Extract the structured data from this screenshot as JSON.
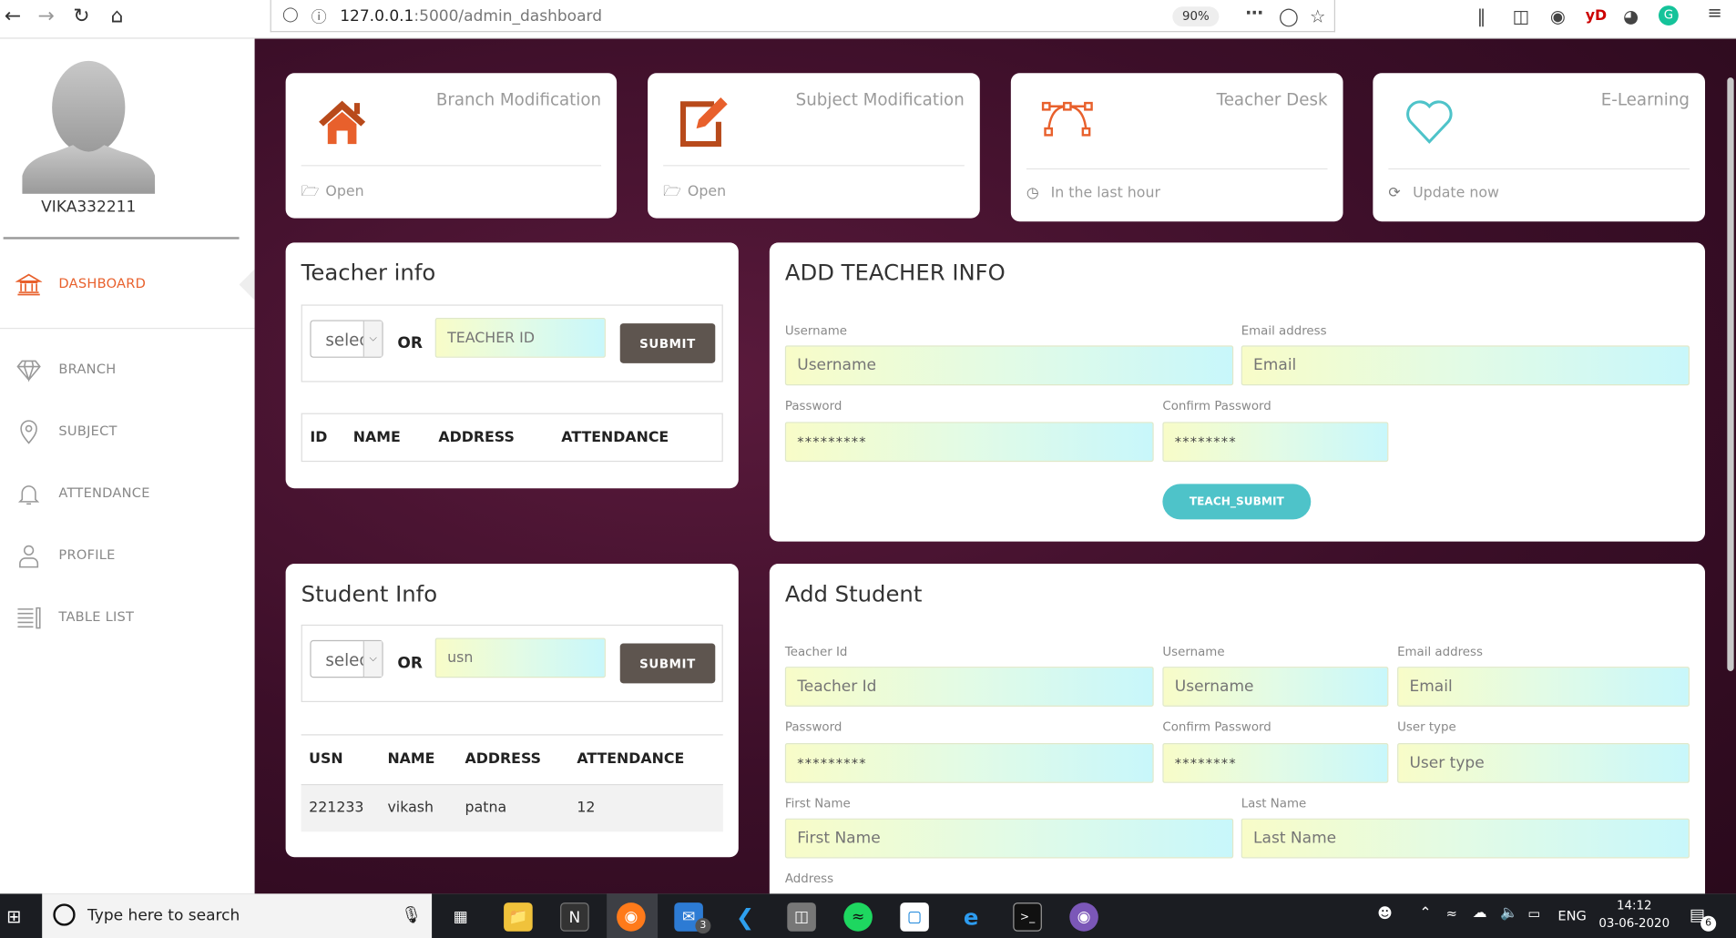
{
  "browser": {
    "url_host": "127.0.0.1",
    "url_rest": ":5000/admin_dashboard",
    "zoom": "90%"
  },
  "sidebar": {
    "username": "VIKA332211",
    "items": [
      {
        "label": "DASHBOARD",
        "icon": "bank-icon",
        "active": true
      },
      {
        "label": "BRANCH",
        "icon": "diamond-icon"
      },
      {
        "label": "SUBJECT",
        "icon": "map-pin-icon"
      },
      {
        "label": "ATTENDANCE",
        "icon": "bell-icon"
      },
      {
        "label": "PROFILE",
        "icon": "user-icon"
      },
      {
        "label": "TABLE LIST",
        "icon": "list-icon"
      }
    ]
  },
  "stats": [
    {
      "title": "Branch Modification",
      "footer": "Open",
      "icon": "home-icon",
      "footer_icon": "folder-open-icon"
    },
    {
      "title": "Subject Modification",
      "footer": "Open",
      "icon": "edit-icon",
      "footer_icon": "folder-open-icon"
    },
    {
      "title": "Teacher Desk",
      "footer": "In the last hour",
      "icon": "vector-path-icon",
      "footer_icon": "clock-icon"
    },
    {
      "title": "E-Learning",
      "footer": "Update now",
      "icon": "heart-icon",
      "footer_icon": "refresh-icon"
    }
  ],
  "teacher_info": {
    "title": "Teacher info",
    "select_value": "selec",
    "or": "OR",
    "input_placeholder": "TEACHER ID",
    "submit": "SUBMIT",
    "columns": [
      "ID",
      "NAME",
      "ADDRESS",
      "ATTENDANCE"
    ]
  },
  "add_teacher": {
    "title": "ADD TEACHER INFO",
    "username_label": "Username",
    "username_placeholder": "Username",
    "email_label": "Email address",
    "email_placeholder": "Email",
    "password_label": "Password",
    "password_value": "*********",
    "confirm_label": "Confirm Password",
    "confirm_value": "********",
    "submit": "TEACH_SUBMIT"
  },
  "student_info": {
    "title": "Student Info",
    "select_value": "selec",
    "or": "OR",
    "input_placeholder": "usn",
    "submit": "SUBMIT",
    "columns": [
      "USN",
      "NAME",
      "ADDRESS",
      "ATTENDANCE"
    ],
    "rows": [
      [
        "221233",
        "vikash",
        "patna",
        "12"
      ]
    ]
  },
  "add_student": {
    "title": "Add Student",
    "teacher_id_label": "Teacher Id",
    "teacher_id_placeholder": "Teacher Id",
    "username_label": "Username",
    "username_placeholder": "Username",
    "email_label": "Email address",
    "email_placeholder": "Email",
    "password_label": "Password",
    "password_value": "*********",
    "confirm_label": "Confirm Password",
    "confirm_value": "********",
    "usertype_label": "User type",
    "usertype_placeholder": "User type",
    "firstname_label": "First Name",
    "firstname_placeholder": "First Name",
    "lastname_label": "Last Name",
    "lastname_placeholder": "Last Name",
    "address_label": "Address"
  },
  "taskbar": {
    "search_text": "Type here to search",
    "mail_badge": "3",
    "language": "ENG",
    "time": "14:12",
    "date": "03-06-2020",
    "notification_count": "6"
  },
  "colors": {
    "accent": "#e8602c",
    "heart": "#4ec3c9",
    "submit_dark": "#5e554f",
    "main_bg": "#3b0e28"
  }
}
